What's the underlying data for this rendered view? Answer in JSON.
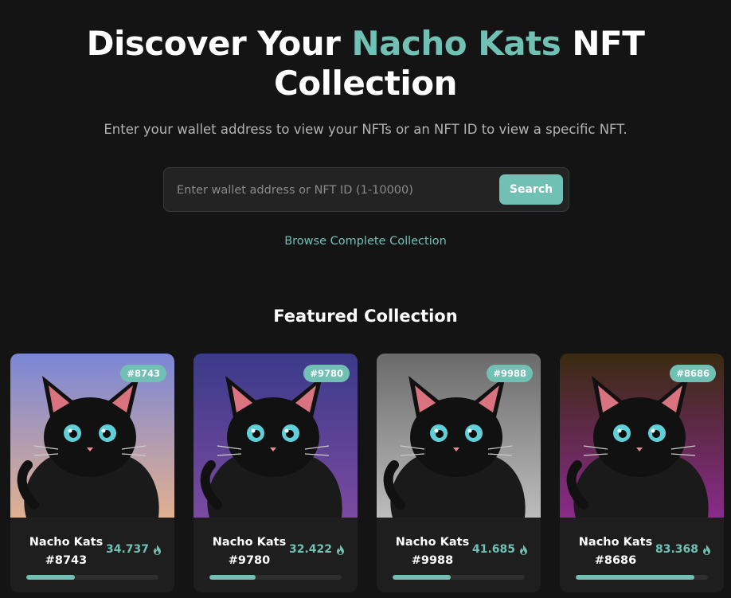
{
  "hero": {
    "title_part1": "Discover Your ",
    "title_accent": "Nacho Kats",
    "title_part2": " NFT Collection",
    "subtitle": "Enter your wallet address to view your NFTs or an NFT ID to view a specific NFT."
  },
  "search": {
    "placeholder": "Enter wallet address or NFT ID (1-10000)",
    "value": "",
    "button_label": "Search"
  },
  "browse_link": "Browse Complete Collection",
  "featured": {
    "title": "Featured Collection",
    "cards": [
      {
        "badge": "#8743",
        "name_line1": "Nacho Kats",
        "name_line2": "#8743",
        "score": "34.737",
        "progress": 0.37,
        "image": "wizard-cat",
        "bg_top": "#7b86d6",
        "bg_bottom": "#e0b090"
      },
      {
        "badge": "#9780",
        "name_line1": "Nacho Kats",
        "name_line2": "#9780",
        "score": "32.422",
        "progress": 0.35,
        "image": "city-night-cat",
        "bg_top": "#3b3a8a",
        "bg_bottom": "#7a4aa0"
      },
      {
        "badge": "#9988",
        "name_line1": "Nacho Kats",
        "name_line2": "#9988",
        "score": "41.685",
        "progress": 0.44,
        "image": "cartoon-grayscale-cat",
        "bg_top": "#6a6a6a",
        "bg_bottom": "#bdbdbd"
      },
      {
        "badge": "#8686",
        "name_line1": "Nacho Kats",
        "name_line2": "#8686",
        "score": "83.368",
        "progress": 0.9,
        "image": "monocle-crystal-cat",
        "bg_top": "#3a2a10",
        "bg_bottom": "#8a2a8a"
      }
    ]
  },
  "colors": {
    "accent": "#71c0b4",
    "background": "#141414",
    "card": "#1e1e1e"
  }
}
